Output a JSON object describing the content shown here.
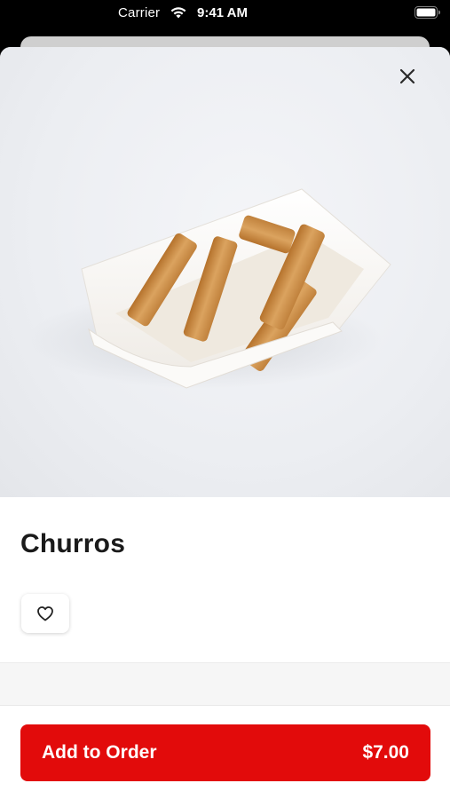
{
  "status_bar": {
    "carrier": "Carrier",
    "time": "9:41 AM"
  },
  "product": {
    "name": "Churros",
    "image_subject": "churros in paper boat"
  },
  "actions": {
    "add_label": "Add to Order",
    "price": "$7.00"
  },
  "icons": {
    "close": "close-icon",
    "favorite": "heart-icon",
    "wifi": "wifi-icon",
    "battery": "battery-icon"
  },
  "colors": {
    "accent": "#e20b0b",
    "title": "#1a1a1a",
    "background": "#ffffff"
  }
}
